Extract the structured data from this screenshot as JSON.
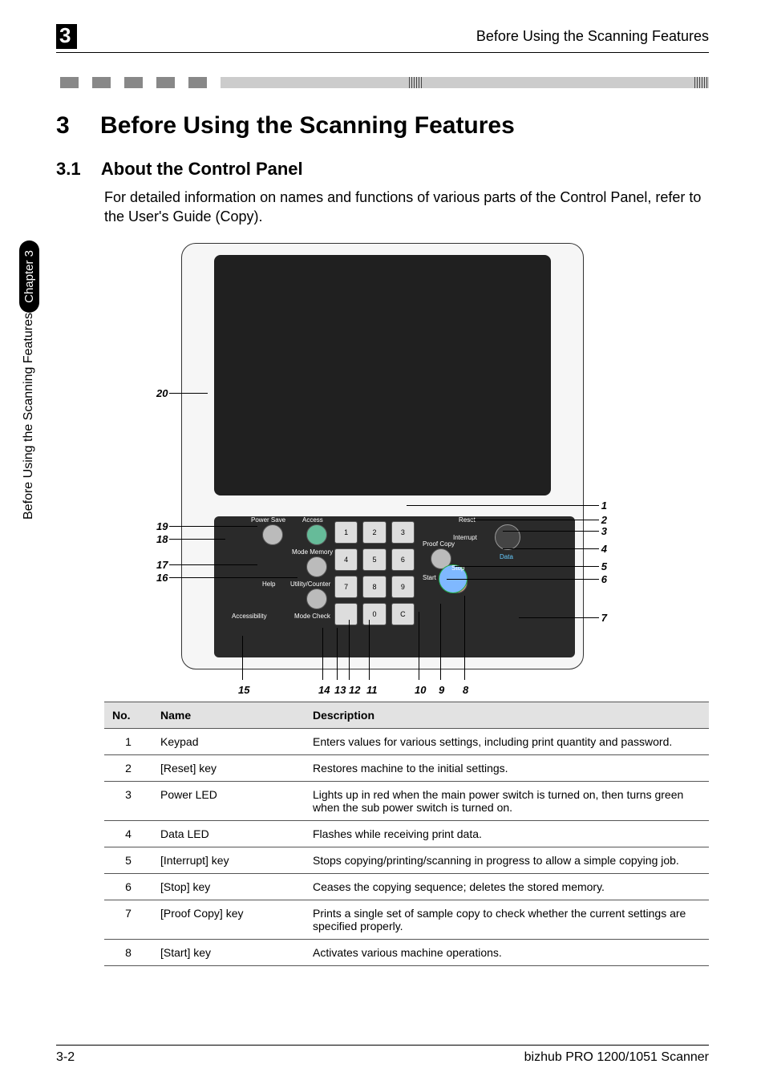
{
  "header": {
    "chapter_number": "3",
    "running_title": "Before Using the Scanning Features"
  },
  "sidetab": {
    "pill": "Chapter 3",
    "label": "Before Using the Scanning Features"
  },
  "chapter": {
    "number": "3",
    "title": "Before Using the Scanning Features"
  },
  "section": {
    "number": "3.1",
    "title": "About the Control Panel",
    "body": "For detailed information on names and functions of various parts of the Control Panel, refer to the User's Guide (Copy)."
  },
  "figure": {
    "callouts_left": {
      "c20": "20",
      "c19": "19",
      "c18": "18",
      "c17": "17",
      "c16": "16"
    },
    "callouts_right": {
      "c1": "1",
      "c2": "2",
      "c3": "3",
      "c4": "4",
      "c5": "5",
      "c6": "6",
      "c7": "7"
    },
    "callouts_bottom": {
      "c15": "15",
      "c14": "14",
      "c13": "13",
      "c12": "12",
      "c11": "11",
      "c10": "10",
      "c9": "9",
      "c8": "8"
    },
    "panel_labels": {
      "reset": "Reset",
      "power_save": "Power Save",
      "access": "Access",
      "mode_memory": "Mode Memory",
      "help": "Help",
      "utility_counter": "Utility/Counter",
      "accessibility": "Accessibility",
      "mode_check": "Mode Check",
      "interrupt": "Interrupt",
      "proof_copy": "Proof Copy",
      "stop": "Stop",
      "data": "Data",
      "start": "Start",
      "key_c": "C"
    }
  },
  "table": {
    "headers": {
      "no": "No.",
      "name": "Name",
      "desc": "Description"
    },
    "rows": [
      {
        "no": "1",
        "name": "Keypad",
        "desc": "Enters values for various settings, including print quantity and password."
      },
      {
        "no": "2",
        "name": "[Reset] key",
        "desc": "Restores machine to the initial settings."
      },
      {
        "no": "3",
        "name": "Power LED",
        "desc": "Lights up in red when the main power switch is turned on, then turns green when the sub power switch is turned on."
      },
      {
        "no": "4",
        "name": "Data LED",
        "desc": "Flashes while receiving print data."
      },
      {
        "no": "5",
        "name": "[Interrupt] key",
        "desc": "Stops copying/printing/scanning in progress to allow a simple copying job."
      },
      {
        "no": "6",
        "name": "[Stop] key",
        "desc": "Ceases the copying sequence; deletes the stored memory."
      },
      {
        "no": "7",
        "name": "[Proof Copy] key",
        "desc": "Prints a single set of sample copy to check whether the current settings are specified properly."
      },
      {
        "no": "8",
        "name": "[Start] key",
        "desc": "Activates various machine operations."
      }
    ]
  },
  "footer": {
    "page": "3-2",
    "product": "bizhub PRO 1200/1051 Scanner"
  }
}
